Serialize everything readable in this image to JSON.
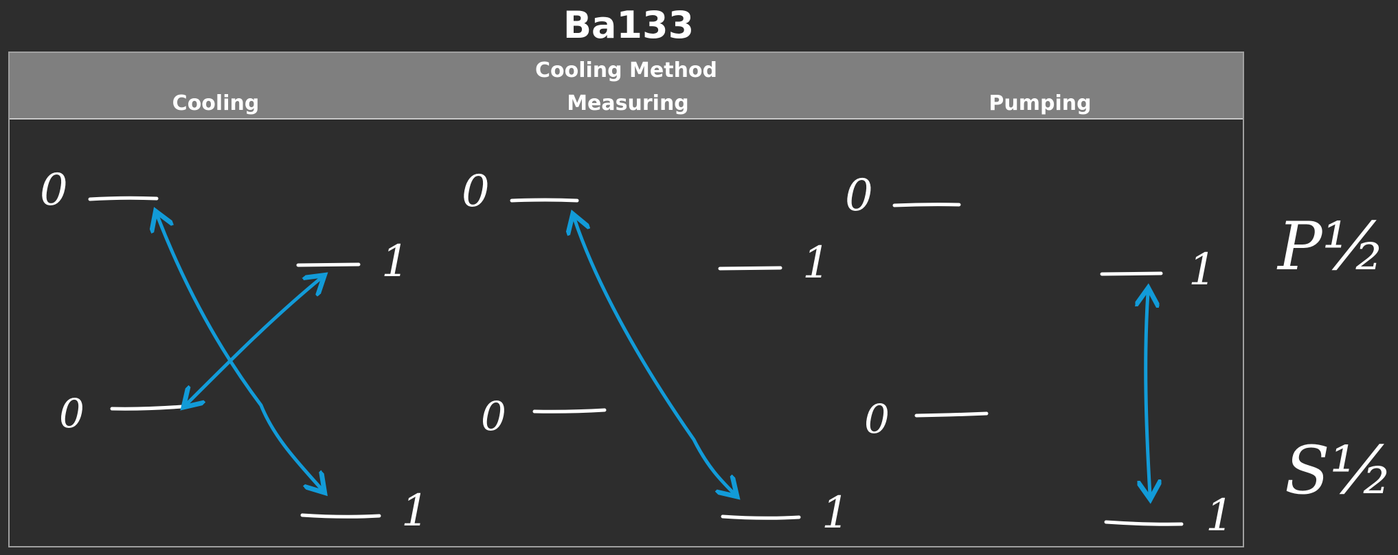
{
  "title": "Ba133",
  "table": {
    "header": "Cooling Method",
    "columns": [
      "Cooling",
      "Measuring",
      "Pumping"
    ]
  },
  "level_labels": {
    "upper_0": "0",
    "upper_1": "1",
    "lower_0": "0",
    "lower_1": "1"
  },
  "term_labels": {
    "upper": "P½",
    "lower": "S½"
  },
  "colors": {
    "background": "#2d2d2d",
    "header_bg": "#7f7f7f",
    "arrow": "#129bd8",
    "ink": "#ffffff"
  }
}
